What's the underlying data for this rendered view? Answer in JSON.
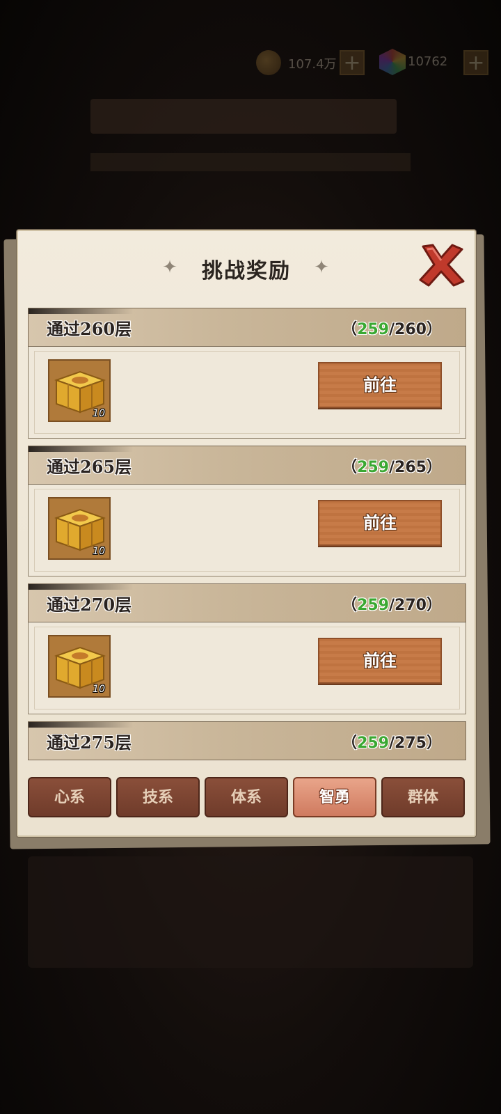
{
  "hud": {
    "coins": "107.4万",
    "gems": "10762",
    "plus": "+"
  },
  "dialog": {
    "title": "挑战奖励",
    "items": [
      {
        "title": "通过260层",
        "open": "（",
        "current": "259",
        "target": "/260",
        "close": "）",
        "reward_count": "10",
        "button": "前往"
      },
      {
        "title": "通过265层",
        "open": "（",
        "current": "259",
        "target": "/265",
        "close": "）",
        "reward_count": "10",
        "button": "前往"
      },
      {
        "title": "通过270层",
        "open": "（",
        "current": "259",
        "target": "/270",
        "close": "）",
        "reward_count": "10",
        "button": "前往"
      },
      {
        "title": "通过275层",
        "open": "（",
        "current": "259",
        "target": "/275",
        "close": "）"
      }
    ],
    "tabs": [
      "心系",
      "技系",
      "体系",
      "智勇",
      "群体"
    ],
    "active_tab": "智勇"
  },
  "colors": {
    "progress_current": "#3aa832",
    "button": "#c77b48",
    "tab_active": "#e9a58a",
    "tab_inactive": "#7a4432",
    "close_x": "#c0392b"
  },
  "icons": {
    "close": "close-x-icon",
    "reward": "treasure-box-icon",
    "title_decor": "shuriken-icon"
  }
}
